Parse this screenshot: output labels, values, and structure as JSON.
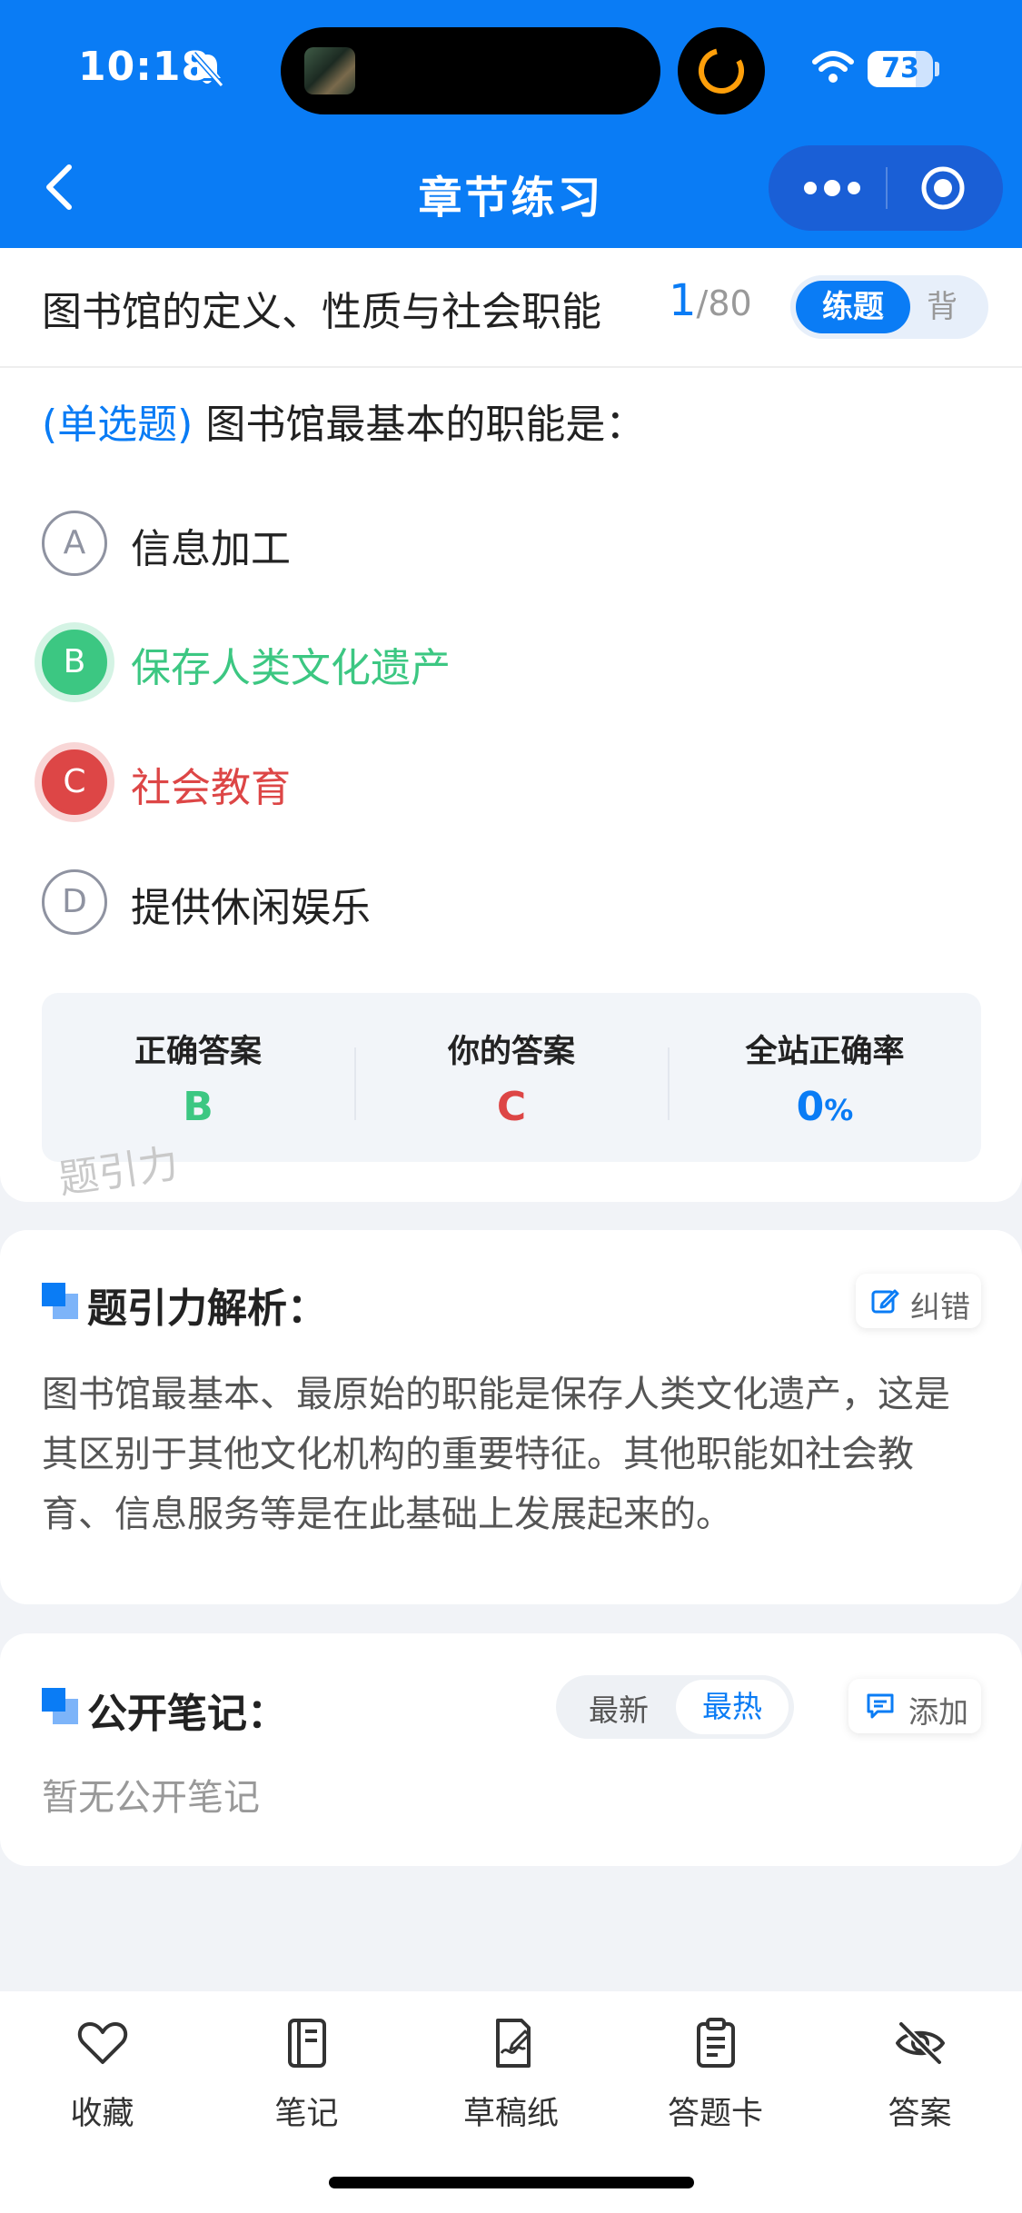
{
  "status_bar": {
    "time": "10:18",
    "battery": "73",
    "battery_level": 0.73
  },
  "nav": {
    "title": "章节练习"
  },
  "question": {
    "chapter_title": "图书馆的定义、性质与社会职能",
    "current": "1",
    "total": "/80",
    "mode_practice": "练题",
    "mode_memorize": "背",
    "type": "(单选题)",
    "text": "图书馆最基本的职能是：",
    "options": [
      {
        "letter": "A",
        "text": "信息加工",
        "state": "normal"
      },
      {
        "letter": "B",
        "text": "保存人类文化遗产",
        "state": "correct"
      },
      {
        "letter": "C",
        "text": "社会教育",
        "state": "wrong"
      },
      {
        "letter": "D",
        "text": "提供休闲娱乐",
        "state": "normal"
      }
    ]
  },
  "answer_summary": {
    "correct_label": "正确答案",
    "correct_value": "B",
    "yours_label": "你的答案",
    "yours_value": "C",
    "rate_label": "全站正确率",
    "rate_value": "0",
    "rate_unit": "%"
  },
  "watermark": "题引力",
  "analysis": {
    "title": "题引力解析：",
    "report_label": "纠错",
    "text": "图书馆最基本、最原始的职能是保存人类文化遗产，这是其区别于其他文化机构的重要特征。其他职能如社会教育、信息服务等是在此基础上发展起来的。"
  },
  "notes": {
    "title": "公开笔记：",
    "sort_new": "最新",
    "sort_hot": "最热",
    "add_label": "添加",
    "empty_text": "暂无公开笔记"
  },
  "tabbar": [
    {
      "label": "收藏",
      "icon": "heart-icon"
    },
    {
      "label": "笔记",
      "icon": "notebook-icon"
    },
    {
      "label": "草稿纸",
      "icon": "draft-paper-icon"
    },
    {
      "label": "答题卡",
      "icon": "answer-sheet-icon"
    },
    {
      "label": "答案",
      "icon": "eye-off-icon"
    }
  ],
  "colors": {
    "primary": "#0a7cf5",
    "correct": "#3cc782",
    "wrong": "#dd4646"
  }
}
